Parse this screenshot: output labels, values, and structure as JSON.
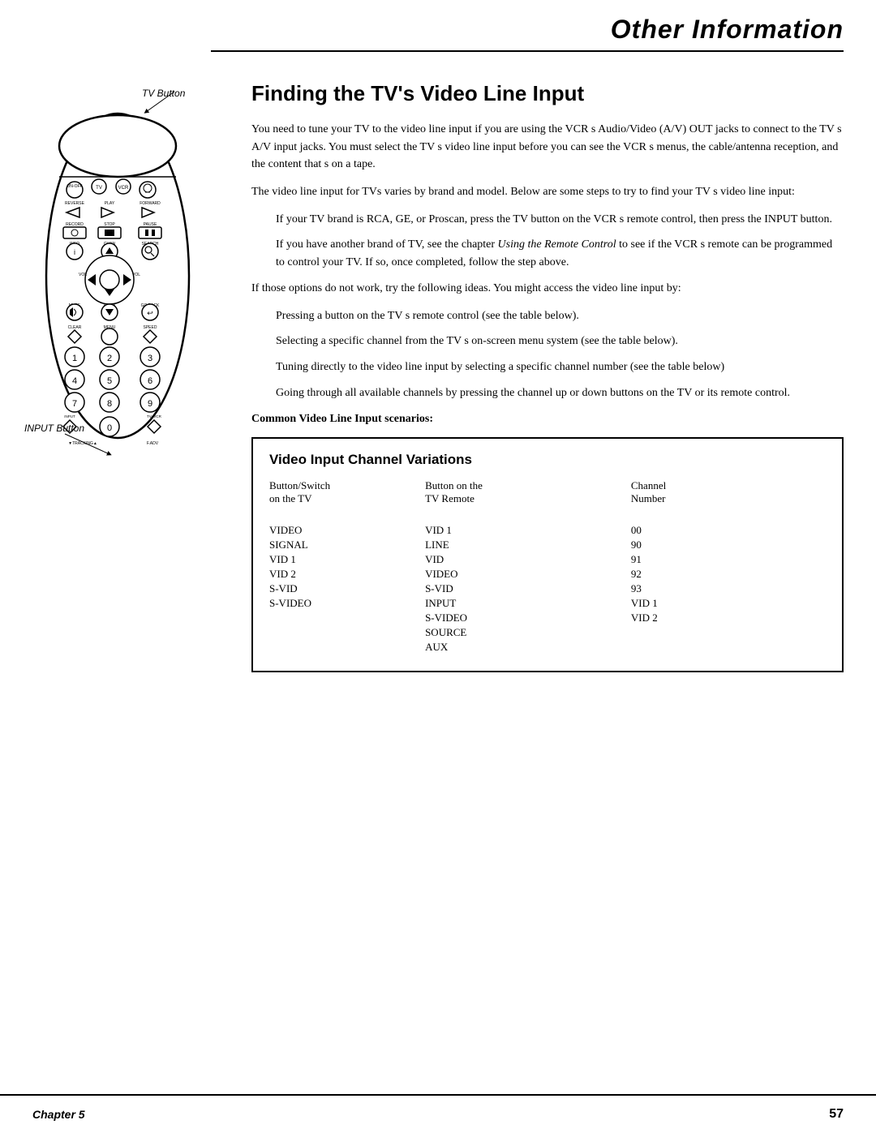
{
  "header": {
    "title": "Other Information",
    "line": true
  },
  "page": {
    "title": "Finding the TV's Video Line Input",
    "paragraphs": [
      "You need to tune your TV to the video line input if you are using the VCR s Audio/Video (A/V) OUT jacks to connect to the TV s A/V input jacks. You must select the TV s video line input before you can see the VCR s menus, the cable/antenna reception, and the content that s on a tape.",
      "The video line input for TVs varies by brand and model. Below are some steps to try to find your TV s video line input:",
      "If your TV brand is RCA, GE, or Proscan, press the TV button on the VCR s remote control, then press the INPUT button.",
      "If you have another brand of TV, see the chapter Using the Remote Control to see if the VCR s remote can be programmed to control your TV. If so, once completed, follow the step above.",
      "If those options do not work, try the following ideas. You might access the video line input by:",
      "Pressing a button on the TV s remote control (see the table below).",
      "Selecting a specific channel from the TV s on-screen menu system (see the table below).",
      "Tuning directly to the video line input by selecting a specific channel number (see the table below)",
      "Going through all available channels by pressing the channel up or down buttons on the TV or its remote control."
    ],
    "bold_header": "Common Video Line Input scenarios:",
    "table": {
      "title": "Video Input Channel Variations",
      "col_headers": [
        "Button/Switch on the TV",
        "Button on the TV Remote",
        "Channel Number"
      ],
      "rows": [
        [
          "VIDEO",
          "VID 1",
          "00"
        ],
        [
          "SIGNAL",
          "LINE",
          "90"
        ],
        [
          "VID 1",
          "VID",
          "91"
        ],
        [
          "VID 2",
          "VIDEO",
          "92"
        ],
        [
          "S-VID",
          "S-VID",
          "93"
        ],
        [
          "S-VIDEO",
          "INPUT",
          "VID 1"
        ],
        [
          "",
          "S-VIDEO",
          "VID 2"
        ],
        [
          "",
          "SOURCE",
          ""
        ],
        [
          "",
          "AUX",
          ""
        ]
      ]
    }
  },
  "labels": {
    "tv_button": "TV Button",
    "input_button": "INPUT\nButton",
    "clear_button": "CLEAR"
  },
  "footer": {
    "chapter": "Chapter 5",
    "page": "57"
  },
  "remote": {
    "buttons": [
      "ON-OFF",
      "TV",
      "VCR",
      "REVERSE",
      "PLAY",
      "FORWARD",
      "RECORD",
      "STOP",
      "PAUSE",
      "INFO",
      "CHAN",
      "SEARCH",
      "VOL",
      "MUTE",
      "CHAN",
      "GO BACK",
      "CLEAR",
      "MENU",
      "SPEED",
      "1",
      "2",
      "3",
      "4",
      "5",
      "6",
      "7",
      "8",
      "9",
      "INPUT",
      "0",
      "TV+VCR",
      "TRACKING",
      "F.ADV"
    ]
  }
}
